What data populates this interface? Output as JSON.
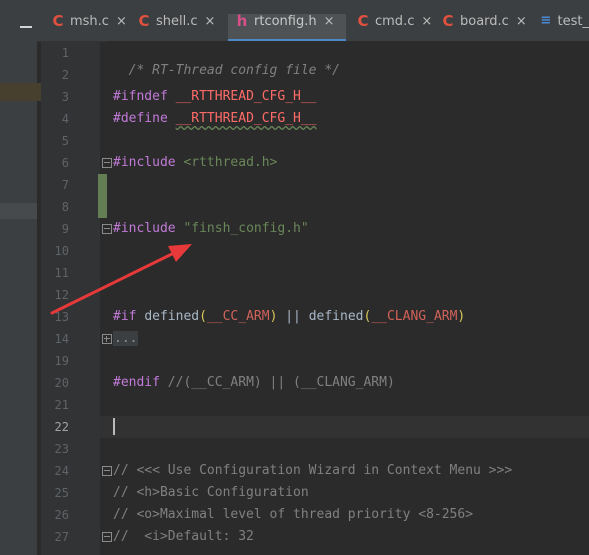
{
  "tabs": [
    {
      "icon": "c-file-icon",
      "label": "msh.c",
      "close": "×"
    },
    {
      "icon": "c-file-icon",
      "label": "shell.c",
      "close": "×"
    },
    {
      "icon": "h-file-icon",
      "label": "rtconfig.h",
      "close": "×",
      "active": true
    },
    {
      "icon": "c-file-icon",
      "label": "cmd.c",
      "close": "×"
    },
    {
      "icon": "c-file-icon",
      "label": "board.c",
      "close": "×"
    },
    {
      "icon": "test-file-icon",
      "label": "test_"
    }
  ],
  "line_numbers": [
    "1",
    "2",
    "3",
    "4",
    "5",
    "6",
    "7",
    "8",
    "9",
    "10",
    "11",
    "12",
    "13",
    "14",
    "19",
    "20",
    "21",
    "22",
    "23",
    "24",
    "25",
    "26",
    "27"
  ],
  "current_line": "22",
  "code": {
    "l1": "/* RT-Thread config file */",
    "l3_kw": "#ifndef",
    "l3_mac": "__RTTHREAD_CFG_H__",
    "l4_kw": "#define",
    "l4_mac": "__RTTHREAD_CFG_H__",
    "l6_kw": "#include",
    "l6_arg": "<rtthread.h>",
    "l9_kw": "#include",
    "l9_arg": "\"finsh_config.h\"",
    "l13_kw": "#if",
    "l13_def1": "defined",
    "l13_p1": "(",
    "l13_m1": "__CC_ARM",
    "l13_p2": ")",
    "l13_or": "||",
    "l13_def2": "defined",
    "l13_p3": "(",
    "l13_m2": "__CLANG_ARM",
    "l13_p4": ")",
    "l14_fold": "...",
    "l20_kw": "#endif",
    "l20_cmt": "//(__CC_ARM) || (__CLANG_ARM)",
    "l24": "// <<< Use Configuration Wizard in Context Menu >>>",
    "l25": "// <h>Basic Configuration",
    "l26": "// <o>Maximal level of thread priority <8-256>",
    "l27": "//  <i>Default: 32"
  },
  "colors": {
    "annotation_arrow": "#e8393a",
    "accent": "#4a88c7"
  }
}
